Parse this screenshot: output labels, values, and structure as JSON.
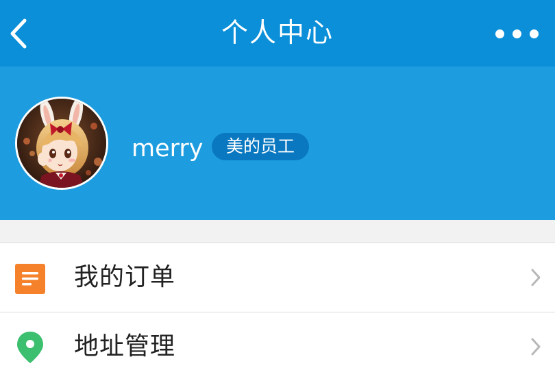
{
  "navbar": {
    "title": "个人中心",
    "back_icon": "chevron-left-icon",
    "more_icon": "more-dots-icon"
  },
  "profile": {
    "username": "merry",
    "badge": "美的员工"
  },
  "menu": {
    "items": [
      {
        "label": "我的订单",
        "icon": "order-list-icon",
        "icon_color": "#f5822a"
      },
      {
        "label": "地址管理",
        "icon": "location-pin-icon",
        "icon_color": "#3cbf6e"
      }
    ]
  },
  "colors": {
    "navbar": "#0a8fd8",
    "profile_bg": "#1d9de0",
    "badge_bg": "#0a78c0"
  }
}
